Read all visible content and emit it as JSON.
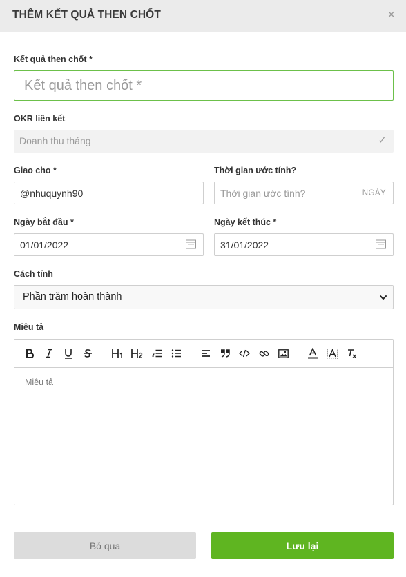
{
  "header": {
    "title": "THÊM KẾT QUẢ THEN CHỐT",
    "close_icon": "×"
  },
  "key_result": {
    "label": "Kết quả then chốt *",
    "placeholder": "Kết quả then chốt *"
  },
  "okr_link": {
    "label": "OKR liên kết",
    "value": "Doanh thu tháng",
    "check": "✓"
  },
  "assign": {
    "label": "Giao cho *",
    "value": "@nhuquynh90"
  },
  "estimate": {
    "label": "Thời gian ước tính?",
    "placeholder": "Thời gian ước tính?",
    "unit": "NGÀY"
  },
  "start_date": {
    "label": "Ngày bắt đầu *",
    "value": "01/01/2022"
  },
  "end_date": {
    "label": "Ngày kết thúc *",
    "value": "31/01/2022"
  },
  "calc": {
    "label": "Cách tính",
    "value": "Phần trăm hoàn thành"
  },
  "description": {
    "label": "Miêu tả",
    "placeholder": "Miêu tả"
  },
  "toolbar_icons": [
    "bold-icon",
    "italic-icon",
    "underline-icon",
    "strikethrough-icon",
    "heading1-icon",
    "heading2-icon",
    "ordered-list-icon",
    "bullet-list-icon",
    "align-left-icon",
    "quote-icon",
    "code-icon",
    "link-icon",
    "image-icon",
    "text-color-icon",
    "background-color-icon",
    "clear-format-icon"
  ],
  "buttons": {
    "cancel": "Bỏ qua",
    "save": "Lưu lại"
  },
  "colors": {
    "accent": "#5fb521",
    "focus_border": "#6cc04a",
    "header_bg": "#ebebeb"
  }
}
